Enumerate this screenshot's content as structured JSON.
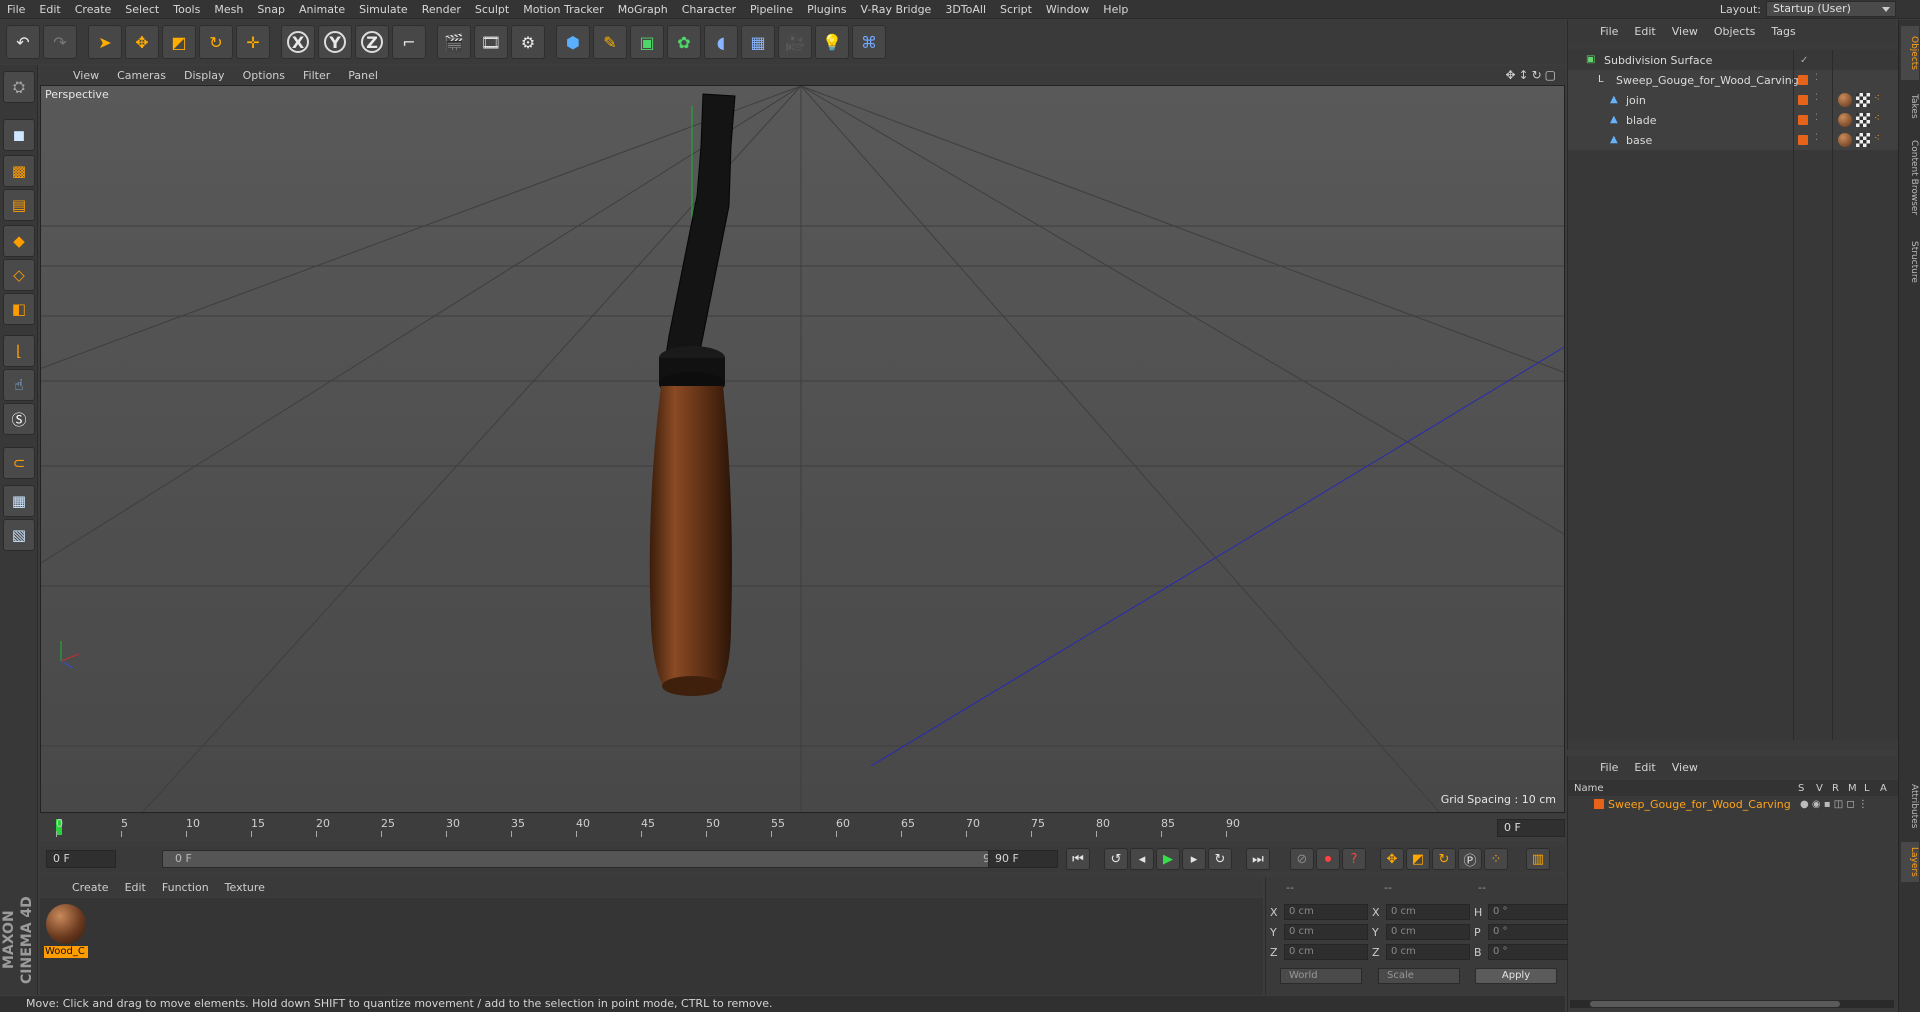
{
  "menubar": {
    "items": [
      "File",
      "Edit",
      "Create",
      "Select",
      "Tools",
      "Mesh",
      "Snap",
      "Animate",
      "Simulate",
      "Render",
      "Sculpt",
      "Motion Tracker",
      "MoGraph",
      "Character",
      "Pipeline",
      "Plugins",
      "V-Ray Bridge",
      "3DToAll",
      "Script",
      "Window",
      "Help"
    ],
    "layout_label": "Layout:",
    "layout_value": "Startup (User)"
  },
  "toolbar": {
    "icons": [
      "undo-icon",
      "redo-icon",
      "select-arrow-icon",
      "move-icon",
      "scale-icon",
      "rotate-icon",
      "transform-icon",
      "x-axis-icon",
      "y-axis-icon",
      "z-axis-icon",
      "world-coords-icon",
      "render-view-icon",
      "render-picture-icon",
      "render-settings-icon",
      "cube-icon",
      "pen-icon",
      "subdivision-icon",
      "cloner-icon",
      "deformer-icon",
      "floor-icon",
      "camera-icon",
      "light-icon",
      "python-icon"
    ],
    "axis_labels": [
      "X",
      "Y",
      "Z"
    ]
  },
  "viewport": {
    "menu": [
      "View",
      "Cameras",
      "Display",
      "Options",
      "Filter",
      "Panel"
    ],
    "label": "Perspective",
    "grid_spacing": "Grid Spacing : 10 cm"
  },
  "timeline": {
    "ticks": [
      "0",
      "5",
      "10",
      "15",
      "20",
      "25",
      "30",
      "35",
      "40",
      "45",
      "50",
      "55",
      "60",
      "65",
      "70",
      "75",
      "80",
      "85",
      "90"
    ],
    "end_field": "0 F"
  },
  "transport": {
    "current": "0 F",
    "slider_start": "0 F",
    "slider_end": "90 F",
    "end": "90 F"
  },
  "material": {
    "menu": [
      "Create",
      "Edit",
      "Function",
      "Texture"
    ],
    "name": "Wood_C"
  },
  "coords": {
    "header": [
      "--",
      "--",
      "--"
    ],
    "rows": [
      {
        "a": "X",
        "v1": "0 cm",
        "b": "X",
        "v2": "0 cm",
        "c": "H",
        "v3": "0 °"
      },
      {
        "a": "Y",
        "v1": "0 cm",
        "b": "Y",
        "v2": "0 cm",
        "c": "P",
        "v3": "0 °"
      },
      {
        "a": "Z",
        "v1": "0 cm",
        "b": "Z",
        "v2": "0 cm",
        "c": "B",
        "v3": "0 °"
      }
    ],
    "space": "World",
    "mode": "Scale",
    "apply": "Apply"
  },
  "status": "Move: Click and drag to move elements. Hold down SHIFT to quantize movement / add to the selection in point mode, CTRL to remove.",
  "brand": "MAXON CINEMA 4D",
  "objects": {
    "menu": [
      "File",
      "Edit",
      "View",
      "Objects",
      "Tags"
    ],
    "items": [
      {
        "name": "Subdivision Surface"
      },
      {
        "name": "Sweep_Gouge_for_Wood_Carving"
      },
      {
        "name": "join"
      },
      {
        "name": "blade"
      },
      {
        "name": "base"
      }
    ]
  },
  "layers": {
    "menu": [
      "File",
      "Edit",
      "View"
    ],
    "header": {
      "name": "Name",
      "cols": [
        "S",
        "V",
        "R",
        "M",
        "L",
        "A"
      ]
    },
    "row": "Sweep_Gouge_for_Wood_Carving"
  },
  "side_tabs": [
    "Objects",
    "Takes",
    "Content Browser",
    "Structure",
    "Attributes",
    "Layers"
  ]
}
